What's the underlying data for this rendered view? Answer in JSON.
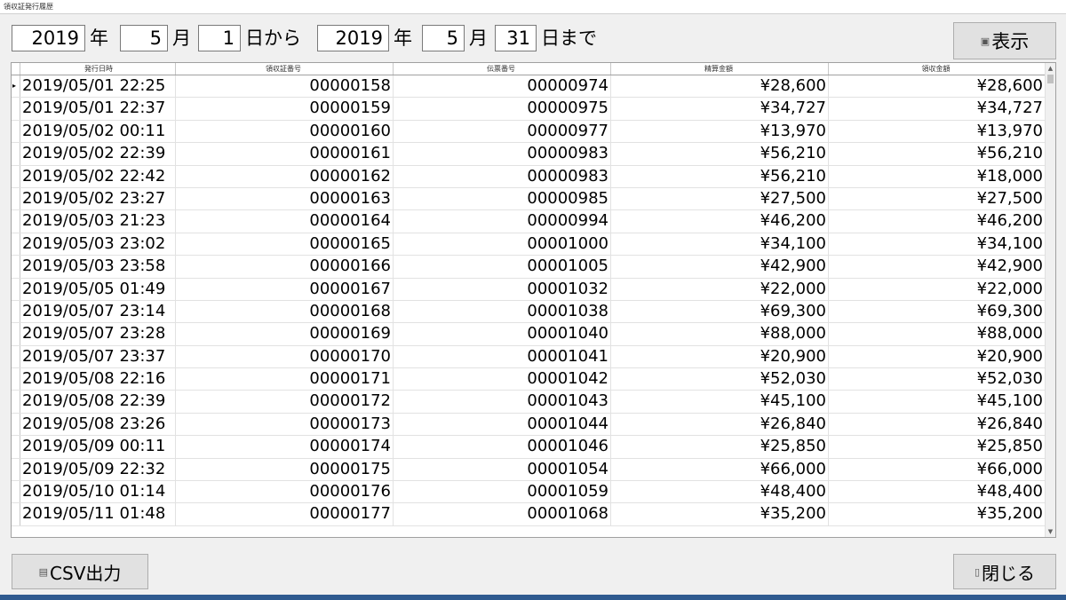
{
  "window": {
    "title": "領収証発行履歴"
  },
  "filter": {
    "from_year": "2019",
    "year_label": "年",
    "from_month": "5",
    "month_label": "月",
    "from_day": "1",
    "from_suffix": "日から",
    "to_year": "2019",
    "to_month": "5",
    "to_day": "31",
    "to_suffix": "日まで"
  },
  "toolbar": {
    "show_label": "表示",
    "csv_label": "CSV出力",
    "close_label": "閉じる"
  },
  "table": {
    "columns": [
      "発行日時",
      "領収証番号",
      "伝票番号",
      "精算金額",
      "領収金額"
    ],
    "rows": [
      [
        "2019/05/01 22:25",
        "00000158",
        "00000974",
        "¥28,600",
        "¥28,600"
      ],
      [
        "2019/05/01 22:37",
        "00000159",
        "00000975",
        "¥34,727",
        "¥34,727"
      ],
      [
        "2019/05/02 00:11",
        "00000160",
        "00000977",
        "¥13,970",
        "¥13,970"
      ],
      [
        "2019/05/02 22:39",
        "00000161",
        "00000983",
        "¥56,210",
        "¥56,210"
      ],
      [
        "2019/05/02 22:42",
        "00000162",
        "00000983",
        "¥56,210",
        "¥18,000"
      ],
      [
        "2019/05/02 23:27",
        "00000163",
        "00000985",
        "¥27,500",
        "¥27,500"
      ],
      [
        "2019/05/03 21:23",
        "00000164",
        "00000994",
        "¥46,200",
        "¥46,200"
      ],
      [
        "2019/05/03 23:02",
        "00000165",
        "00001000",
        "¥34,100",
        "¥34,100"
      ],
      [
        "2019/05/03 23:58",
        "00000166",
        "00001005",
        "¥42,900",
        "¥42,900"
      ],
      [
        "2019/05/05 01:49",
        "00000167",
        "00001032",
        "¥22,000",
        "¥22,000"
      ],
      [
        "2019/05/07 23:14",
        "00000168",
        "00001038",
        "¥69,300",
        "¥69,300"
      ],
      [
        "2019/05/07 23:28",
        "00000169",
        "00001040",
        "¥88,000",
        "¥88,000"
      ],
      [
        "2019/05/07 23:37",
        "00000170",
        "00001041",
        "¥20,900",
        "¥20,900"
      ],
      [
        "2019/05/08 22:16",
        "00000171",
        "00001042",
        "¥52,030",
        "¥52,030"
      ],
      [
        "2019/05/08 22:39",
        "00000172",
        "00001043",
        "¥45,100",
        "¥45,100"
      ],
      [
        "2019/05/08 23:26",
        "00000173",
        "00001044",
        "¥26,840",
        "¥26,840"
      ],
      [
        "2019/05/09 00:11",
        "00000174",
        "00001046",
        "¥25,850",
        "¥25,850"
      ],
      [
        "2019/05/09 22:32",
        "00000175",
        "00001054",
        "¥66,000",
        "¥66,000"
      ],
      [
        "2019/05/10 01:14",
        "00000176",
        "00001059",
        "¥48,400",
        "¥48,400"
      ],
      [
        "2019/05/11 01:48",
        "00000177",
        "00001068",
        "¥35,200",
        "¥35,200"
      ]
    ]
  }
}
